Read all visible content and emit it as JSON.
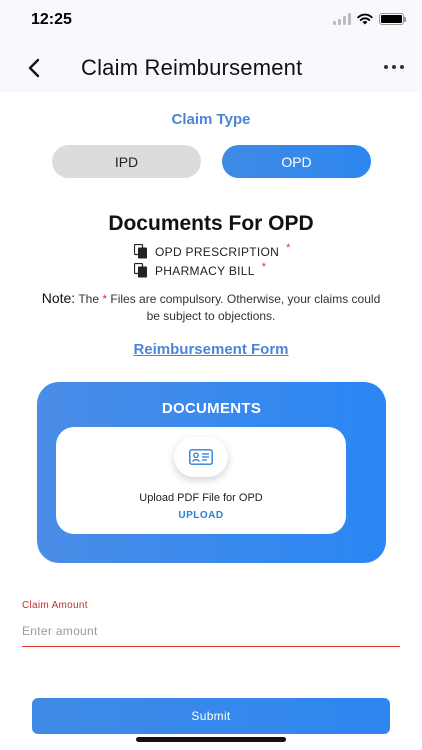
{
  "status_bar": {
    "time": "12:25"
  },
  "header": {
    "title": "Claim Reimbursement"
  },
  "claim_type": {
    "label": "Claim Type",
    "options": [
      "IPD",
      "OPD"
    ],
    "selected": "OPD"
  },
  "documents": {
    "heading": "Documents For OPD",
    "items": [
      {
        "label": "OPD PRESCRIPTION",
        "required_mark": "*"
      },
      {
        "label": "PHARMACY BILL",
        "required_mark": "*"
      }
    ],
    "note_label": "Note:",
    "note_text_before": "The",
    "note_star": "*",
    "note_text_after": "Files are compulsory. Otherwise, your claims could be subject to objections."
  },
  "reimbursement_form_link": "Reimbursement Form",
  "upload_card": {
    "title": "DOCUMENTS",
    "text": "Upload PDF File for OPD",
    "button": "UPLOAD"
  },
  "claim_amount": {
    "label": "Claim Amount",
    "placeholder": "Enter amount",
    "value": ""
  },
  "submit_label": "Submit",
  "colors": {
    "accent": "#2e86f0",
    "link": "#4a86d8",
    "required": "#e0342c"
  },
  "icons": {
    "back": "chevron-left-icon",
    "more": "more-horizontal-icon",
    "document": "document-copy-icon",
    "upload": "id-card-icon"
  }
}
